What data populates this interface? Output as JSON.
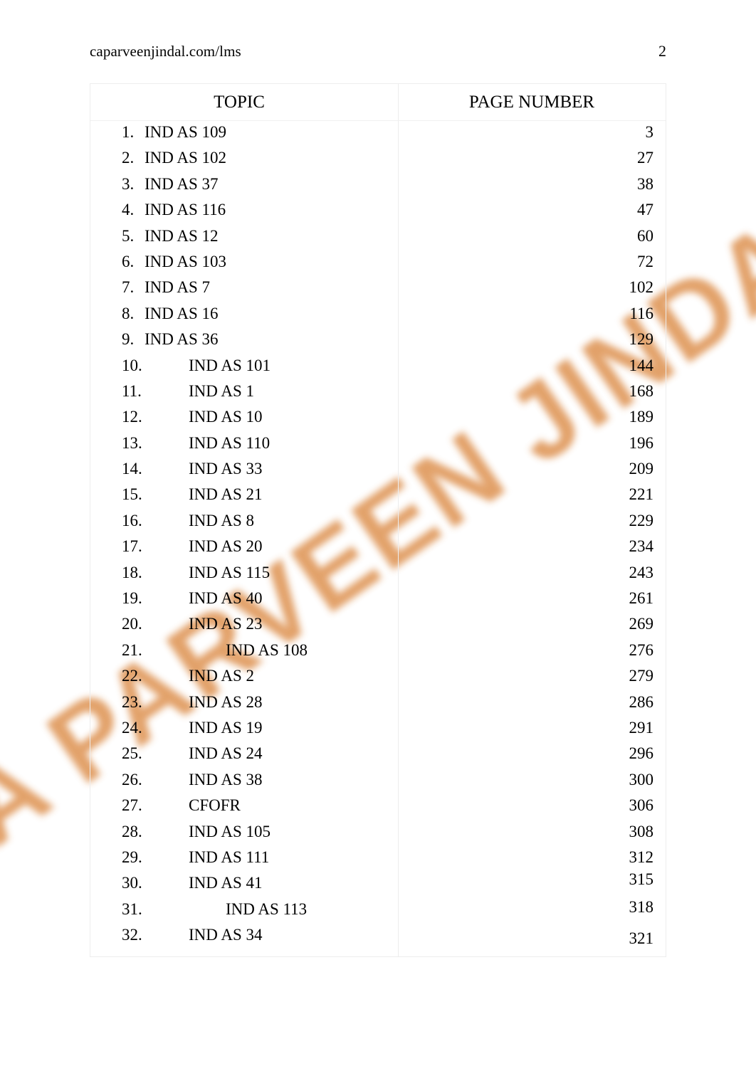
{
  "header": {
    "url": "caparveenjindal.com/lms",
    "page_number": "2"
  },
  "watermark": {
    "text": "CA PARVEEN JINDAL",
    "color": "#e09a5e"
  },
  "table": {
    "columns": {
      "topic": "TOPIC",
      "page_number": "PAGE NUMBER"
    },
    "rows": [
      {
        "num": "1.",
        "topic": "IND AS 109",
        "page": "3"
      },
      {
        "num": "2.",
        "topic": "IND AS 102",
        "page": "27"
      },
      {
        "num": "3.",
        "topic": "IND AS 37",
        "page": "38"
      },
      {
        "num": "4.",
        "topic": "IND AS 116",
        "page": "47"
      },
      {
        "num": "5.",
        "topic": "IND AS 12",
        "page": "60"
      },
      {
        "num": "6.",
        "topic": "IND AS 103",
        "page": "72"
      },
      {
        "num": "7.",
        "topic": "IND AS 7",
        "page": "102"
      },
      {
        "num": "8.",
        "topic": "IND AS 16",
        "page": "116"
      },
      {
        "num": "9.",
        "topic": "IND AS 36",
        "page": "129"
      },
      {
        "num": "10.",
        "topic": "IND AS 101",
        "page": "144"
      },
      {
        "num": "11.",
        "topic": "IND AS 1",
        "page": "168"
      },
      {
        "num": "12.",
        "topic": "IND AS 10",
        "page": "189"
      },
      {
        "num": "13.",
        "topic": "IND AS 110",
        "page": "196"
      },
      {
        "num": "14.",
        "topic": "IND AS 33",
        "page": "209"
      },
      {
        "num": "15.",
        "topic": "IND AS 21",
        "page": "221"
      },
      {
        "num": "16.",
        "topic": "IND AS 8",
        "page": "229"
      },
      {
        "num": "17.",
        "topic": "IND AS 20",
        "page": "234"
      },
      {
        "num": "18.",
        "topic": "IND AS 115",
        "page": "243"
      },
      {
        "num": "19.",
        "topic": "IND AS 40",
        "page": "261"
      },
      {
        "num": "20.",
        "topic": "IND AS 23",
        "page": "269"
      },
      {
        "num": "21.",
        "topic": "IND AS 108",
        "page": "276"
      },
      {
        "num": "22.",
        "topic": "IND AS 2",
        "page": "279"
      },
      {
        "num": "23.",
        "topic": "IND AS 28",
        "page": "286"
      },
      {
        "num": "24.",
        "topic": "IND AS 19",
        "page": "291"
      },
      {
        "num": "25.",
        "topic": "IND AS 24",
        "page": "296"
      },
      {
        "num": "26.",
        "topic": "IND AS 38",
        "page": "300"
      },
      {
        "num": "27.",
        "topic": "CFOFR",
        "page": "306"
      },
      {
        "num": "28.",
        "topic": "IND AS 105",
        "page": "308"
      },
      {
        "num": "29.",
        "topic": "IND AS 111",
        "page": "312"
      },
      {
        "num": "30.",
        "topic": "IND AS 41",
        "page": "315"
      },
      {
        "num": "31.",
        "topic": "IND AS 113",
        "page": "318"
      },
      {
        "num": "32.",
        "topic": "IND AS 34",
        "page": "321"
      }
    ]
  }
}
